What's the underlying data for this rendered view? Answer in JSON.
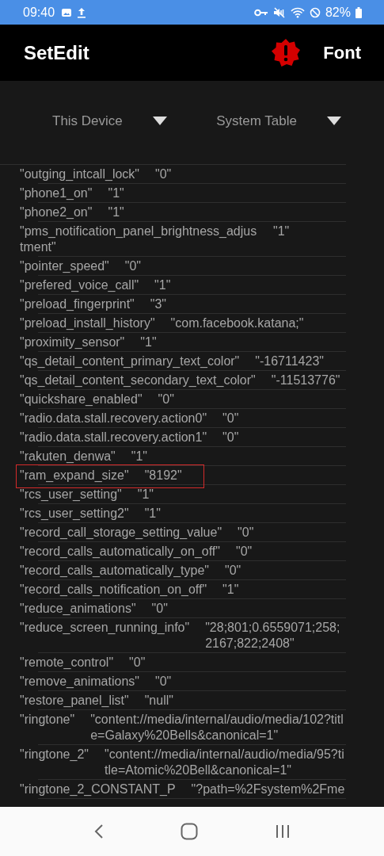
{
  "status_bar": {
    "time": "09:40",
    "battery": "82%"
  },
  "app_bar": {
    "title": "SetEdit",
    "action": "Font"
  },
  "selectors": [
    {
      "label": "This Device"
    },
    {
      "label": "System Table"
    }
  ],
  "rows": [
    {
      "key": "\"outging_intcall_lock\"",
      "value": "\"0\"",
      "highlighted": false
    },
    {
      "key": "\"phone1_on\"",
      "value": "\"1\"",
      "highlighted": false
    },
    {
      "key": "\"phone2_on\"",
      "value": "\"1\"",
      "highlighted": false
    },
    {
      "key": "\"pms_notification_panel_brightness_adjustment\"",
      "value": "\"1\"",
      "highlighted": false
    },
    {
      "key": "\"pointer_speed\"",
      "value": "\"0\"",
      "highlighted": false
    },
    {
      "key": "\"prefered_voice_call\"",
      "value": "\"1\"",
      "highlighted": false
    },
    {
      "key": "\"preload_fingerprint\"",
      "value": "\"3\"",
      "highlighted": false
    },
    {
      "key": "\"preload_install_history\"",
      "value": "\"com.facebook.katana;\"",
      "highlighted": false
    },
    {
      "key": "\"proximity_sensor\"",
      "value": "\"1\"",
      "highlighted": false
    },
    {
      "key": "\"qs_detail_content_primary_text_color\"",
      "value": "\"-16711423\"",
      "highlighted": false
    },
    {
      "key": "\"qs_detail_content_secondary_text_color\"",
      "value": "\"-11513776\"",
      "highlighted": false
    },
    {
      "key": "\"quickshare_enabled\"",
      "value": "\"0\"",
      "highlighted": false
    },
    {
      "key": "\"radio.data.stall.recovery.action0\"",
      "value": "\"0\"",
      "highlighted": false
    },
    {
      "key": "\"radio.data.stall.recovery.action1\"",
      "value": "\"0\"",
      "highlighted": false
    },
    {
      "key": "\"rakuten_denwa\"",
      "value": "\"1\"",
      "highlighted": false
    },
    {
      "key": "\"ram_expand_size\"",
      "value": "\"8192\"",
      "highlighted": true
    },
    {
      "key": "\"rcs_user_setting\"",
      "value": "\"1\"",
      "highlighted": false
    },
    {
      "key": "\"rcs_user_setting2\"",
      "value": "\"1\"",
      "highlighted": false
    },
    {
      "key": "\"record_call_storage_setting_value\"",
      "value": "\"0\"",
      "highlighted": false
    },
    {
      "key": "\"record_calls_automatically_on_off\"",
      "value": "\"0\"",
      "highlighted": false
    },
    {
      "key": "\"record_calls_automatically_type\"",
      "value": "\"0\"",
      "highlighted": false
    },
    {
      "key": "\"record_calls_notification_on_off\"",
      "value": "\"1\"",
      "highlighted": false
    },
    {
      "key": "\"reduce_animations\"",
      "value": "\"0\"",
      "highlighted": false
    },
    {
      "key": "\"reduce_screen_running_info\"",
      "value": "\"28;801;0.6559071;258;2167;822;2408\"",
      "highlighted": false
    },
    {
      "key": "\"remote_control\"",
      "value": "\"0\"",
      "highlighted": false
    },
    {
      "key": "\"remove_animations\"",
      "value": "\"0\"",
      "highlighted": false
    },
    {
      "key": "\"restore_panel_list\"",
      "value": "\"null\"",
      "highlighted": false
    },
    {
      "key": "\"ringtone\"",
      "value": "\"content://media/internal/audio/media/102?title=Galaxy%20Bells&canonical=1\"",
      "highlighted": false
    },
    {
      "key": "\"ringtone_2\"",
      "value": "\"content://media/internal/audio/media/95?title=Atomic%20Bell&canonical=1\"",
      "highlighted": false
    },
    {
      "key": "\"ringtone_2_CONSTANT_P",
      "value": "\"?path=%2Fsystem%2Fme",
      "highlighted": false
    }
  ]
}
